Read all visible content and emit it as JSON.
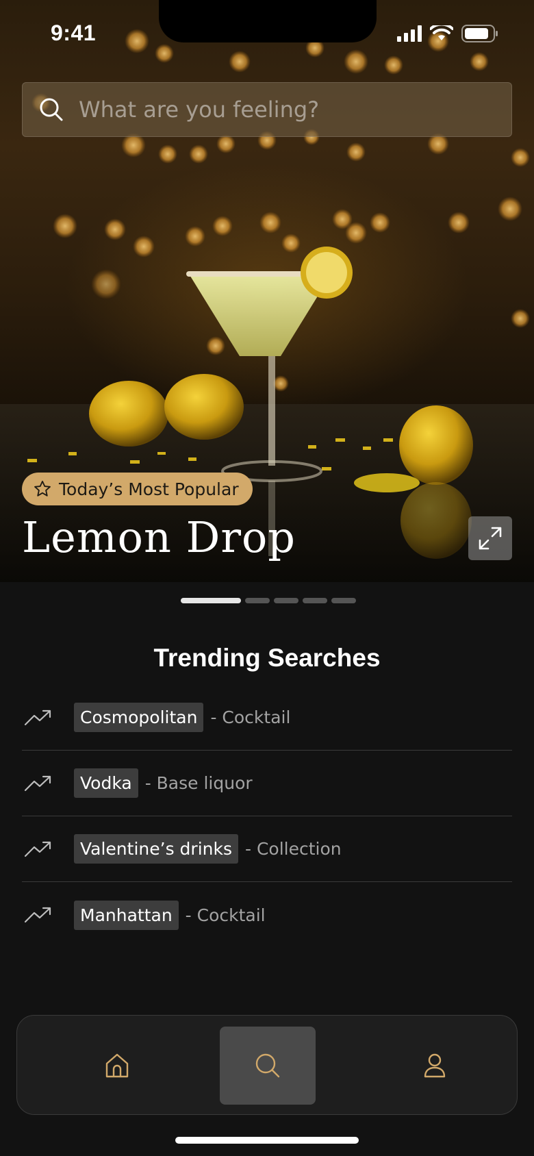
{
  "status_bar": {
    "time": "9:41",
    "icons": [
      "cellular-signal-icon",
      "wifi-icon",
      "battery-icon"
    ]
  },
  "search": {
    "placeholder": "What are you feeling?",
    "icon": "search-icon"
  },
  "hero": {
    "badge_label": "Today’s Most Popular",
    "badge_icon": "star-icon",
    "title": "Lemon Drop",
    "expand_icon": "expand-icon",
    "image_subject": "lemon-drop-cocktail-photo"
  },
  "pager": {
    "count": 5,
    "active_index": 0
  },
  "trending": {
    "title": "Trending Searches",
    "items": [
      {
        "name": "Cosmopolitan",
        "type": "- Cocktail"
      },
      {
        "name": "Vodka",
        "type": "- Base liquor"
      },
      {
        "name": "Valentine’s drinks",
        "type": "- Collection"
      },
      {
        "name": "Manhattan",
        "type": "- Cocktail"
      }
    ]
  },
  "bottom_nav": {
    "items": [
      {
        "icon": "home-icon",
        "active": false
      },
      {
        "icon": "search-icon",
        "active": true
      },
      {
        "icon": "profile-icon",
        "active": false
      }
    ]
  },
  "colors": {
    "background": "#121212",
    "accent_gold": "#d2a96a",
    "chip_bg": "#3d3d3d",
    "secondary_text": "#a3a3a3",
    "nav_active_bg": "#4a4a4a"
  }
}
